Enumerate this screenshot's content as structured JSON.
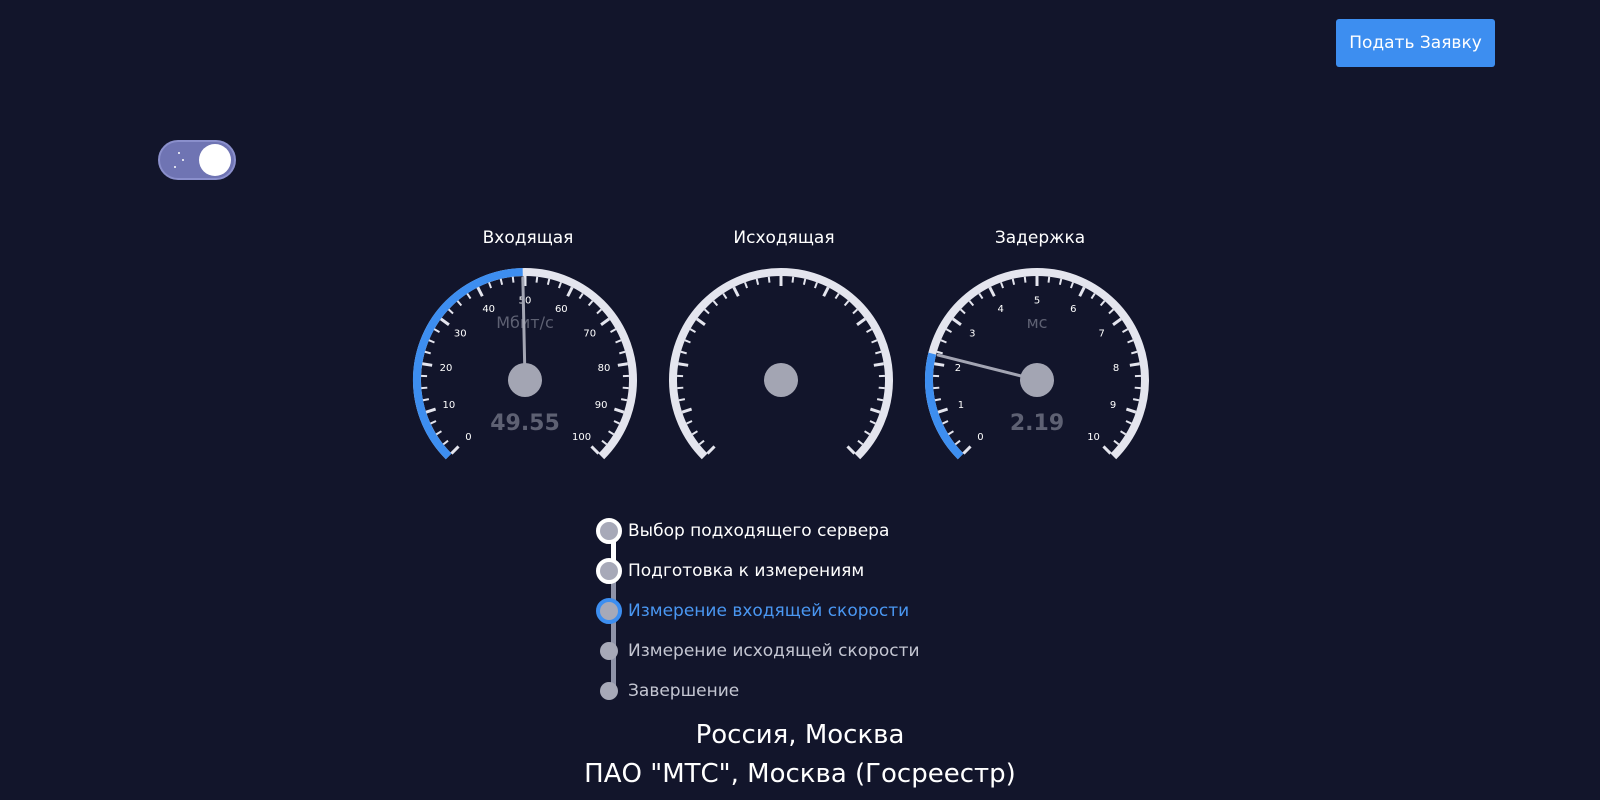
{
  "header": {
    "submit_button_label": "Подать Заявку"
  },
  "theme_toggle": {
    "state": "dark",
    "icon": "stars-icon"
  },
  "colors": {
    "background": "#12152b",
    "accent": "#3d8ef0",
    "dial": "#e4e5ee",
    "pointer": "#a3a5b3",
    "readout": "#5e6173"
  },
  "gauges": [
    {
      "key": "download",
      "title": "Входящая",
      "unit": "Мбит/с",
      "value_label": "49.55",
      "value": 49.55,
      "min": 0,
      "max": 100,
      "tick_labels": [
        "0",
        "10",
        "20",
        "30",
        "40",
        "50",
        "60",
        "70",
        "80",
        "90",
        "100"
      ]
    },
    {
      "key": "upload",
      "title": "Исходящая",
      "unit": "",
      "value_label": "",
      "value": null,
      "min": 0,
      "max": 100,
      "tick_labels": []
    },
    {
      "key": "latency",
      "title": "Задержка",
      "unit": "мс",
      "value_label": "2.19",
      "value": 2.19,
      "min": 0,
      "max": 10,
      "tick_labels": [
        "0",
        "1",
        "2",
        "3",
        "4",
        "5",
        "6",
        "7",
        "8",
        "9",
        "10"
      ]
    }
  ],
  "steps": [
    {
      "label": "Выбор подходящего сервера",
      "status": "done"
    },
    {
      "label": "Подготовка к измерениям",
      "status": "done"
    },
    {
      "label": "Измерение входящей скорости",
      "status": "active"
    },
    {
      "label": "Измерение исходящей скорости",
      "status": "pending"
    },
    {
      "label": "Завершение",
      "status": "pending"
    }
  ],
  "location": "Россия, Москва",
  "provider": "ПАО \"МТС\", Москва (Госреестр)"
}
